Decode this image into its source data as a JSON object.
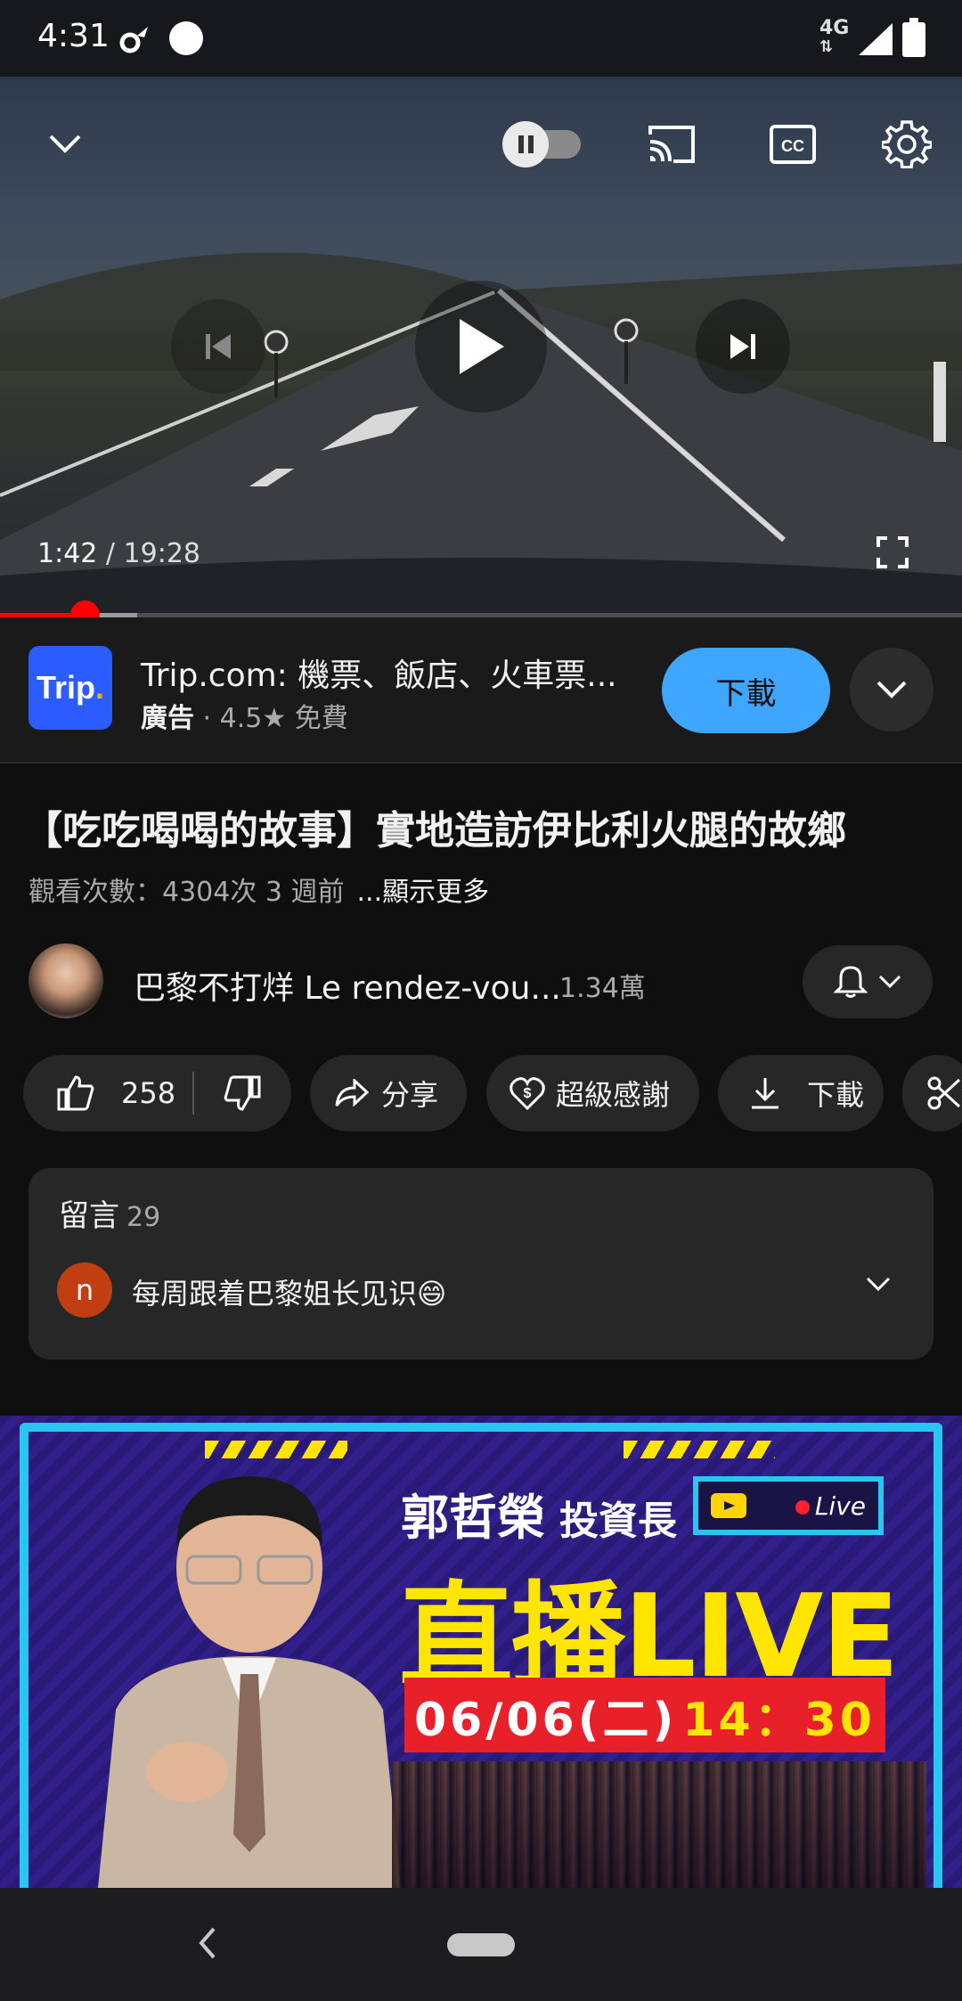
{
  "status_bar": {
    "time": "4:31",
    "network": "4G"
  },
  "player": {
    "current_time": "1:42",
    "total_time": " / 19:28",
    "progress_fraction": 0.088,
    "buffer_fraction": 0.143,
    "autoplay_on": false,
    "controls": {
      "collapse_icon": "chevron-down-icon",
      "autoplay_icon": "pause-toggle-icon",
      "cast_icon": "cast-icon",
      "captions_icon": "cc-icon",
      "settings_icon": "gear-icon",
      "prev_icon": "skip-previous-icon",
      "play_icon": "play-icon",
      "next_icon": "skip-next-icon",
      "fullscreen_icon": "fullscreen-icon"
    }
  },
  "ad": {
    "logo_text": "Trip",
    "logo_dot": ".",
    "title": "Trip.com: 機票、飯店、火車票...",
    "badge": "廣告",
    "rating": " · 4.5★  ",
    "price": "免費",
    "download_label": "下載"
  },
  "video": {
    "title": "【吃吃喝喝的故事】實地造訪伊比利火腿的故鄉",
    "views": "觀看次數：4304次  3 週前",
    "show_more": "...顯示更多"
  },
  "channel": {
    "name": "巴黎不打烊 Le rendez-vou...",
    "subscribers": "1.34萬"
  },
  "actions": {
    "likes": "258",
    "share": "分享",
    "super_thanks": "超級感謝",
    "download": "下載"
  },
  "comments": {
    "header": "留言",
    "count": "29",
    "first_author_initial": "n",
    "first_comment": "每周跟着巴黎姐长见识😄"
  },
  "banner": {
    "name": "郭哲榮",
    "role": "投資長",
    "live_tag": "Live",
    "headline": "直播LIVE",
    "date": "06/06(二)",
    "time": "14：30"
  },
  "colors": {
    "accent_red": "#ff0000",
    "download_blue": "#3ea6ff",
    "background": "#0f0f0f",
    "chip_bg": "#272727"
  }
}
